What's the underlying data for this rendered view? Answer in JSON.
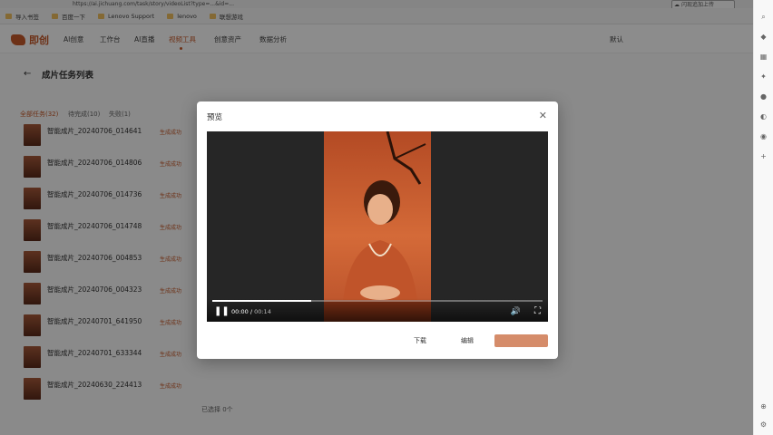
{
  "browser": {
    "url": "https://ai.jichuang.com/task/story/videoList?type=...&id=...",
    "upload_label": "闪现追加上传",
    "bookmarks": [
      "导入书签",
      "百度一下",
      "Lenovo Support",
      "lenovo",
      "联想游戏"
    ]
  },
  "app": {
    "logo": "即创",
    "nav": [
      "AI创意",
      "工作台",
      "AI直播",
      "视频工具",
      "创意资产",
      "数据分析"
    ],
    "active_nav": 3,
    "user": "默认"
  },
  "page": {
    "title": "成片任务列表",
    "tabs": [
      "全部任务(32)",
      "待完成(10)",
      "失败(1)"
    ],
    "list": [
      {
        "title": "智能成片_20240706_014641",
        "status": "生成成功"
      },
      {
        "title": "智能成片_20240706_014806",
        "status": "生成成功"
      },
      {
        "title": "智能成片_20240706_014736",
        "status": "生成成功"
      },
      {
        "title": "智能成片_20240706_014748",
        "status": "生成成功"
      },
      {
        "title": "智能成片_20240706_004853",
        "status": "生成成功"
      },
      {
        "title": "智能成片_20240706_004323",
        "status": "生成成功"
      },
      {
        "title": "智能成片_20240701_641950",
        "status": "生成成功"
      },
      {
        "title": "智能成片_20240701_633344",
        "status": "生成成功"
      },
      {
        "title": "智能成片_20240630_224413",
        "status": "生成成功"
      }
    ],
    "selected": "已选择 0个"
  },
  "modal": {
    "title": "预览",
    "time_current": "00:00",
    "time_separator": "/",
    "time_total": "00:14",
    "progress": 0.3,
    "download": "下载",
    "edit": "编辑"
  }
}
